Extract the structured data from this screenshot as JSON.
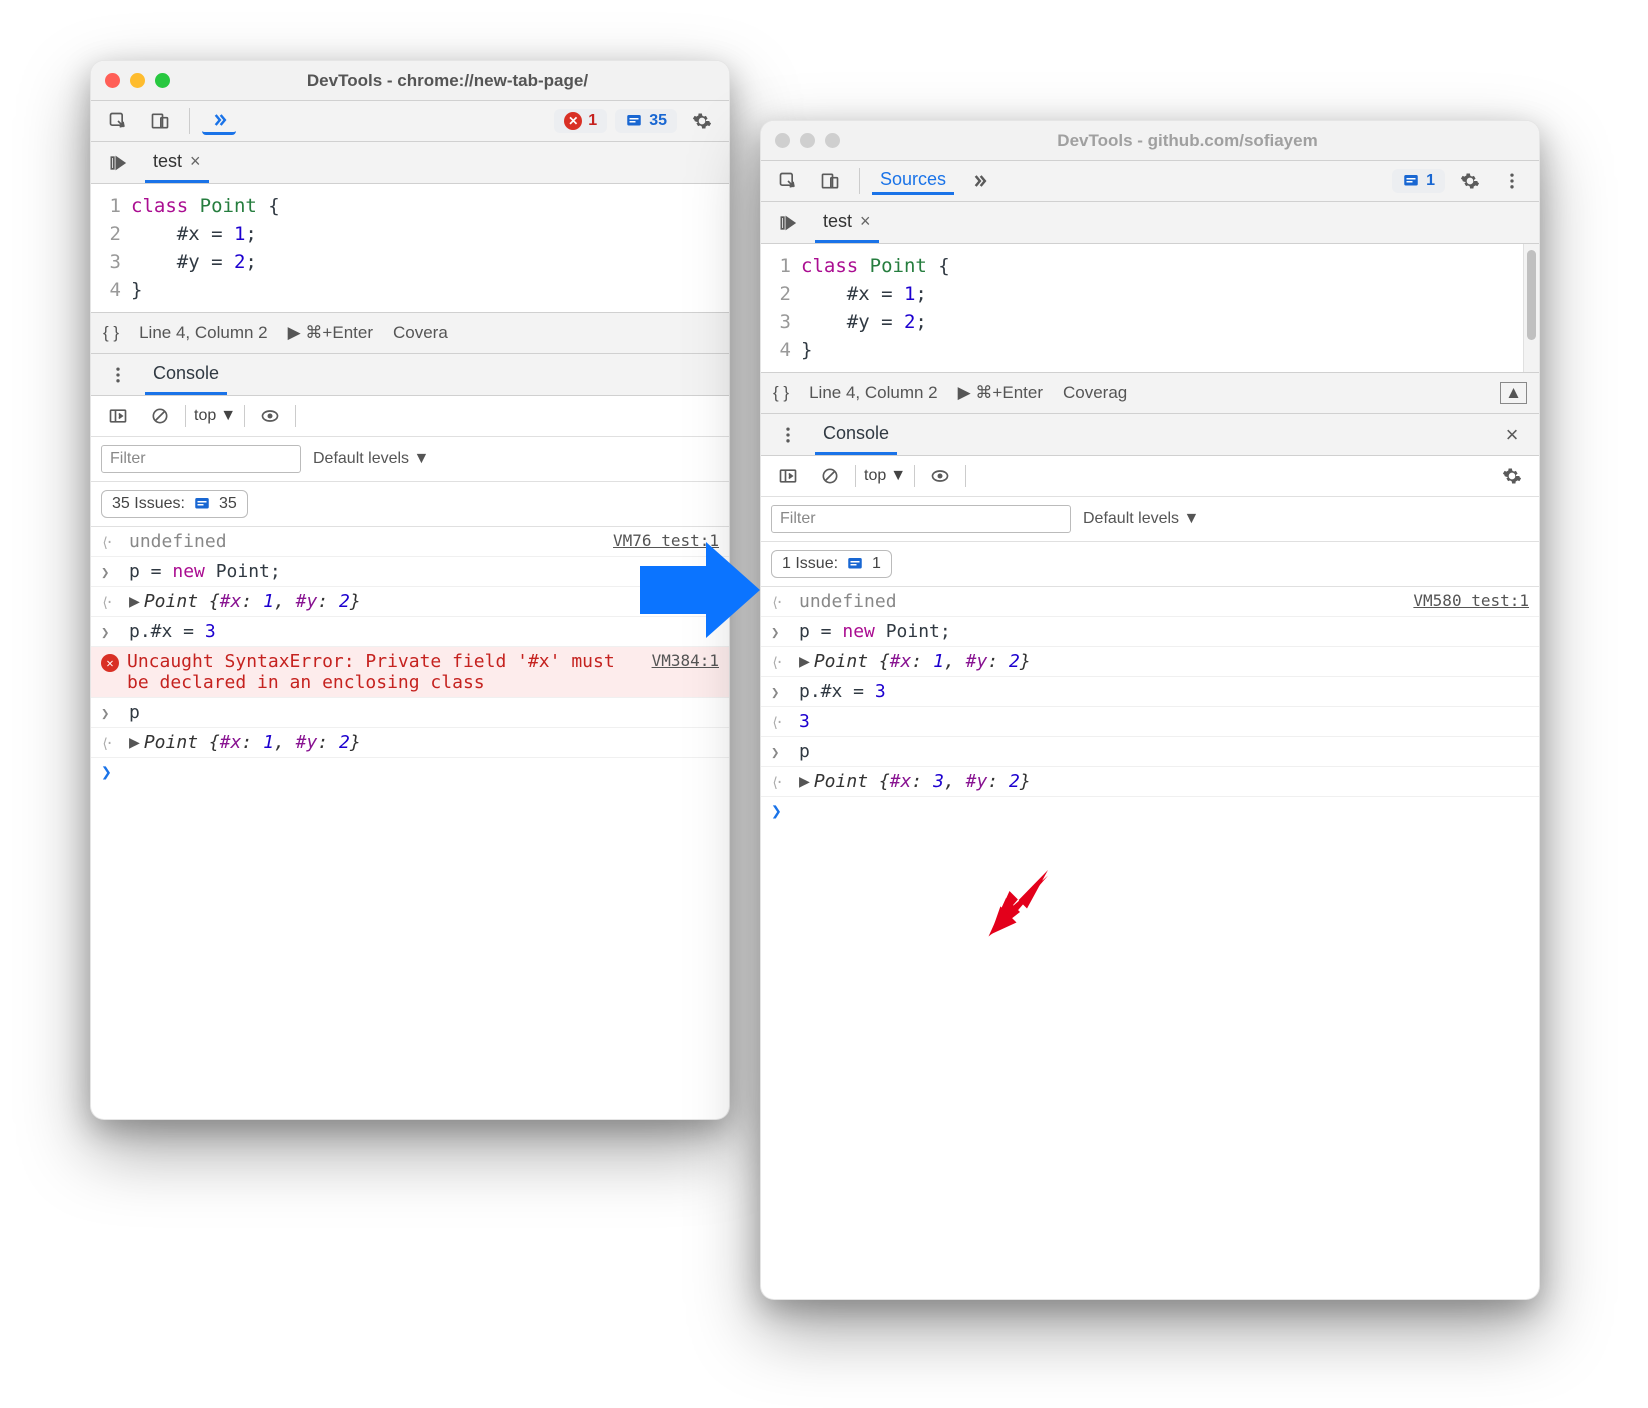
{
  "left": {
    "title": "DevTools - chrome://new-tab-page/",
    "errors": "1",
    "issues": "35",
    "tab": "test",
    "code_lines": [
      "class Point {",
      "    #x = 1;",
      "    #y = 2;",
      "}"
    ],
    "status_pos": "Line 4, Column 2",
    "status_run": "⌘+Enter",
    "status_cov": "Covera",
    "drawer_tab": "Console",
    "context": "top",
    "filter_ph": "Filter",
    "levels": "Default levels ▼",
    "issues_label": "35 Issues:",
    "issues_count": "35",
    "rows": {
      "r0": {
        "text": "undefined",
        "link": "VM76 test:1"
      },
      "r1": {
        "pre": "p = ",
        "kw": "new",
        "post": " Point;"
      },
      "r2": {
        "pre": "Point ",
        "k1": "#x",
        "v1": "1",
        "k2": "#y",
        "v2": "2"
      },
      "r3": {
        "pre": "p.#x = ",
        "val": "3"
      },
      "r4": {
        "text": "Uncaught SyntaxError: Private field '#x' must be declared in an enclosing class",
        "link": "VM384:1"
      },
      "r5": {
        "text": "p"
      },
      "r6": {
        "pre": "Point ",
        "k1": "#x",
        "v1": "1",
        "k2": "#y",
        "v2": "2"
      }
    }
  },
  "right": {
    "title": "DevTools - github.com/sofiayem",
    "panel": "Sources",
    "issues": "1",
    "tab": "test",
    "code_lines": [
      "class Point {",
      "    #x = 1;",
      "    #y = 2;",
      "}"
    ],
    "status_pos": "Line 4, Column 2",
    "status_run": "⌘+Enter",
    "status_cov": "Coverag",
    "drawer_tab": "Console",
    "context": "top",
    "filter_ph": "Filter",
    "levels": "Default levels ▼",
    "issues_label": "1 Issue:",
    "issues_count": "1",
    "rows": {
      "r0": {
        "text": "undefined",
        "link": "VM580 test:1"
      },
      "r1": {
        "pre": "p = ",
        "kw": "new",
        "post": " Point;"
      },
      "r2": {
        "pre": "Point ",
        "k1": "#x",
        "v1": "1",
        "k2": "#y",
        "v2": "2"
      },
      "r3": {
        "pre": "p.#x = ",
        "val": "3"
      },
      "r4": {
        "text": "3"
      },
      "r5": {
        "text": "p"
      },
      "r6": {
        "pre": "Point ",
        "k1": "#x",
        "v1": "3",
        "k2": "#y",
        "v2": "2"
      }
    }
  }
}
